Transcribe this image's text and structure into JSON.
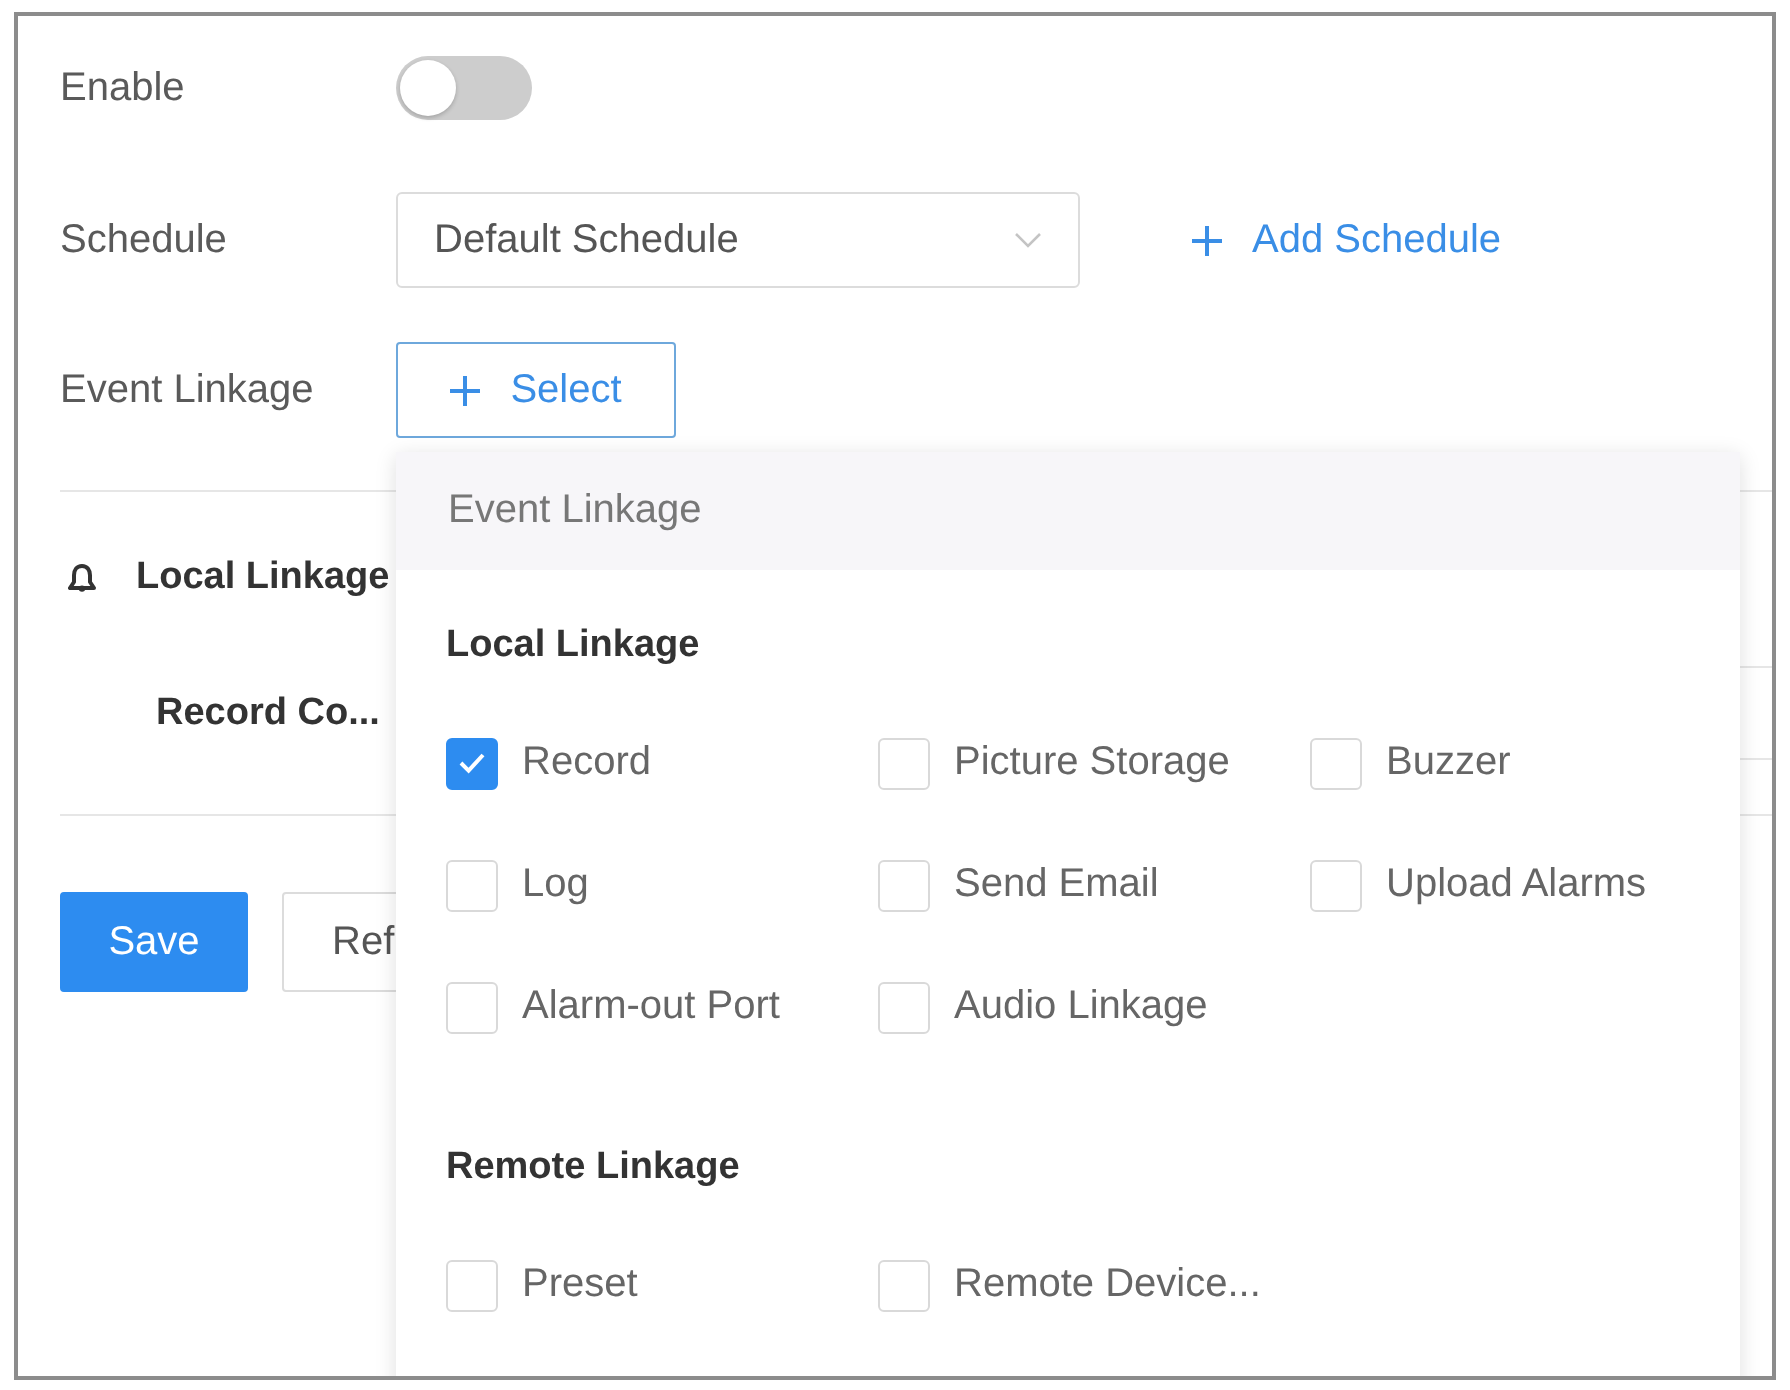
{
  "settings": {
    "enable": {
      "label": "Enable",
      "on": false
    },
    "schedule": {
      "label": "Schedule",
      "value": "Default Schedule",
      "link": "Add Schedule"
    },
    "event_linkage": {
      "label": "Event Linkage",
      "button": "Select"
    }
  },
  "linkage_section": {
    "title": "Local Linkage",
    "row_label": "Record Co..."
  },
  "buttons": [
    {
      "label": "Save",
      "kind": "primary"
    },
    {
      "label": "Ref",
      "kind": "default"
    }
  ],
  "dropdown": {
    "header": "Event Linkage",
    "groups": [
      {
        "title": "Local Linkage",
        "options": [
          {
            "label": "Record",
            "checked": true
          },
          {
            "label": "Picture Storage",
            "checked": false
          },
          {
            "label": "Buzzer",
            "checked": false
          },
          {
            "label": "Log",
            "checked": false
          },
          {
            "label": "Send Email",
            "checked": false
          },
          {
            "label": "Upload Alarms",
            "checked": false
          },
          {
            "label": "Alarm-out Port",
            "checked": false
          },
          {
            "label": "Audio Linkage",
            "checked": false
          }
        ]
      },
      {
        "title": "Remote Linkage",
        "options": [
          {
            "label": "Preset",
            "checked": false
          },
          {
            "label": "Remote Device...",
            "checked": false
          }
        ]
      }
    ]
  }
}
